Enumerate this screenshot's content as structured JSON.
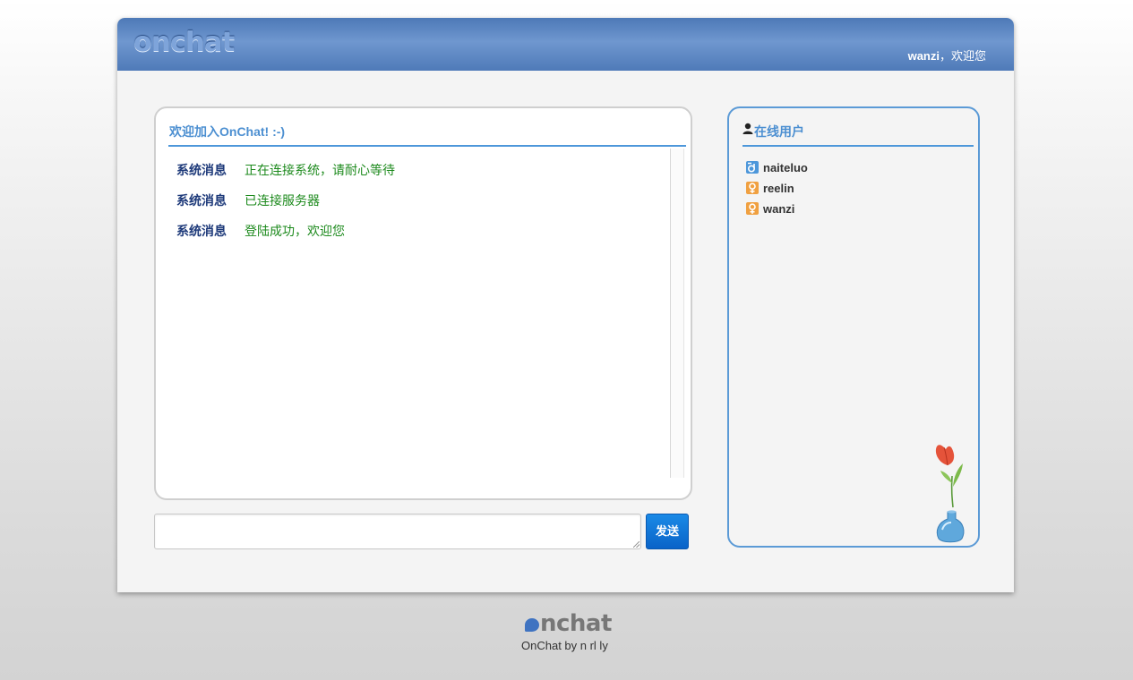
{
  "app": {
    "logo": "onchat",
    "greeting_user": "wanzi",
    "greeting_suffix": "，欢迎您"
  },
  "chat": {
    "title": "欢迎加入OnChat! :-)",
    "messages": [
      {
        "sender": "系统消息",
        "text": "正在连接系统，请耐心等待"
      },
      {
        "sender": "系统消息",
        "text": "已连接服务器"
      },
      {
        "sender": "系统消息",
        "text": "登陆成功，欢迎您"
      }
    ],
    "input_value": "",
    "send_label": "发送"
  },
  "users": {
    "title": "在线用户",
    "list": [
      {
        "name": "naiteluo",
        "gender": "male",
        "icon": "male-icon"
      },
      {
        "name": "reelin",
        "gender": "female",
        "icon": "female-icon"
      },
      {
        "name": "wanzi",
        "gender": "female",
        "icon": "female-icon"
      }
    ]
  },
  "footer": {
    "logo": "nchat",
    "credit": "OnChat by n rl ly"
  },
  "colors": {
    "header": "#5b86c4",
    "accent": "#4d97da",
    "sender": "#1e3a7a",
    "message": "#1d8a1d",
    "send_button": "#0a63c8"
  }
}
